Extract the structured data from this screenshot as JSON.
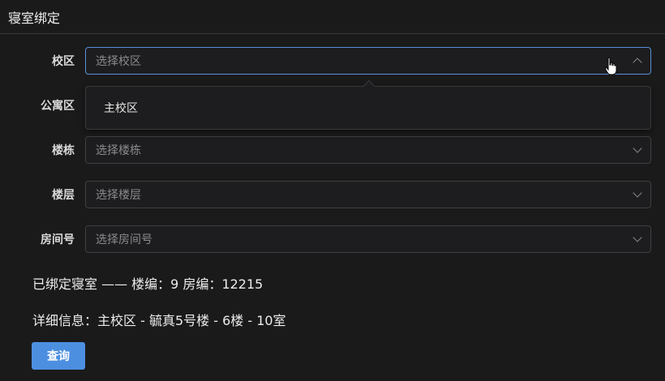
{
  "dialog": {
    "title": "寝室绑定"
  },
  "form": {
    "campus": {
      "label": "校区",
      "placeholder": "选择校区",
      "state": "open"
    },
    "apartment": {
      "label": "公寓区"
    },
    "building": {
      "label": "楼栋",
      "placeholder": "选择楼栋"
    },
    "floor": {
      "label": "楼层",
      "placeholder": "选择楼层"
    },
    "room": {
      "label": "房间号",
      "placeholder": "选择房间号"
    }
  },
  "dropdown": {
    "options": [
      "主校区"
    ]
  },
  "info": {
    "bound_line": "已绑定寝室 —— 楼编：9 房编：12215",
    "detail_line": "详细信息：主校区 - 毓真5号楼 - 6楼 - 10室"
  },
  "actions": {
    "query_label": "查询"
  },
  "colors": {
    "background": "#1a1a1b",
    "accent": "#4c8fe0",
    "focus_border": "#5a8fd8"
  },
  "icons": {
    "select_arrow": "chevron-down-icon",
    "select_arrow_open": "chevron-up-icon",
    "cursor": "hand-pointer-icon"
  }
}
